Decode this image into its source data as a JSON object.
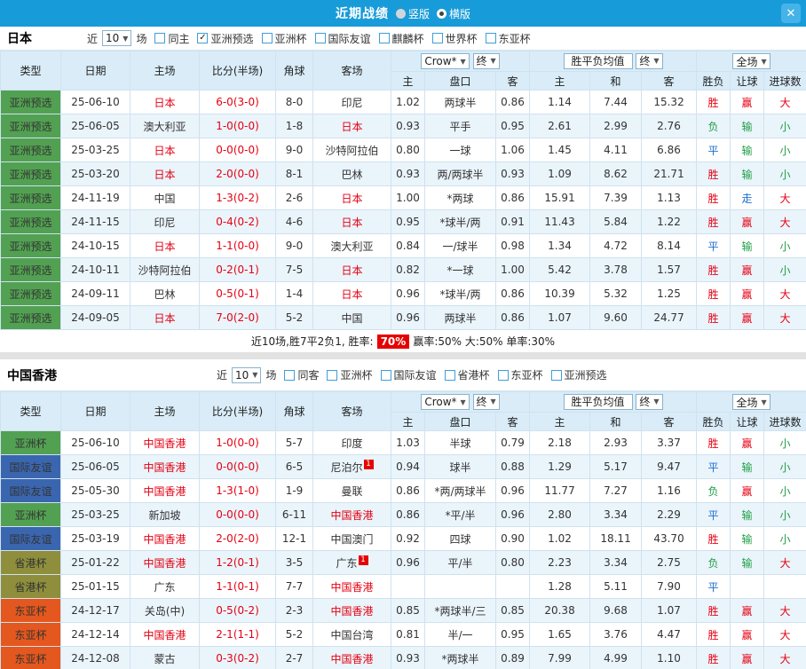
{
  "topbar": {
    "title": "近期战绩",
    "layout_options": [
      {
        "label": "竖版",
        "selected": false
      },
      {
        "label": "横版",
        "selected": true
      }
    ],
    "close_label": "✕"
  },
  "icons": {
    "dropdown": "▼",
    "check": "✓",
    "close": "✕"
  },
  "controls": {
    "near": "近",
    "games": "场",
    "odds_source": "Crow*",
    "final": "终",
    "avg_label": "胜平负均值",
    "scope": "全场"
  },
  "columns": {
    "type": "类型",
    "date": "日期",
    "home": "主场",
    "score": "比分(半场)",
    "corner": "角球",
    "away": "客场",
    "home_short": "主",
    "handicap": "盘口",
    "away_short": "客",
    "avg_home": "主",
    "avg_draw": "和",
    "avg_away": "客",
    "result": "胜负",
    "handicap_result": "让球",
    "goals": "进球数"
  },
  "colors": {
    "accent": "#189bd9",
    "score": "#e60012",
    "focus_team": "#e60012",
    "types": {
      "亚洲预选": "#52a152",
      "亚洲杯": "#52a152",
      "国际友谊": "#3a66b0",
      "省港杯": "#8e8e3c",
      "东亚杯": "#e4571e"
    },
    "outcomes": {
      "胜": "#e60012",
      "负": "#1f9e46",
      "平": "#1d6fd1",
      "赢": "#e60012",
      "输": "#1f9e46",
      "走": "#1d6fd1",
      "大": "#e60012",
      "小": "#1f9e46"
    }
  },
  "sections": [
    {
      "team": "日本",
      "filter": {
        "count": "10",
        "checkboxes": [
          {
            "label": "同主",
            "checked": false
          },
          {
            "label": "亚洲预选",
            "checked": true
          },
          {
            "label": "亚洲杯",
            "checked": false
          },
          {
            "label": "国际友谊",
            "checked": false
          },
          {
            "label": "麒麟杯",
            "checked": false
          },
          {
            "label": "世界杯",
            "checked": false
          },
          {
            "label": "东亚杯",
            "checked": false
          }
        ]
      },
      "rows": [
        {
          "type": "亚洲预选",
          "date": "25-06-10",
          "home": "日本",
          "score": "6-0(3-0)",
          "corner": "8-0",
          "away": "印尼",
          "o1": "1.02",
          "hc": "两球半",
          "o2": "0.86",
          "e1": "1.14",
          "e2": "7.44",
          "e3": "15.32",
          "wl": "胜",
          "rq": "赢",
          "gl": "大"
        },
        {
          "type": "亚洲预选",
          "date": "25-06-05",
          "home": "澳大利亚",
          "score": "1-0(0-0)",
          "corner": "1-8",
          "away": "日本",
          "o1": "0.93",
          "hc": "平手",
          "o2": "0.95",
          "e1": "2.61",
          "e2": "2.99",
          "e3": "2.76",
          "wl": "负",
          "rq": "输",
          "gl": "小"
        },
        {
          "type": "亚洲预选",
          "date": "25-03-25",
          "home": "日本",
          "score": "0-0(0-0)",
          "corner": "9-0",
          "away": "沙特阿拉伯",
          "o1": "0.80",
          "hc": "一球",
          "o2": "1.06",
          "e1": "1.45",
          "e2": "4.11",
          "e3": "6.86",
          "wl": "平",
          "rq": "输",
          "gl": "小"
        },
        {
          "type": "亚洲预选",
          "date": "25-03-20",
          "home": "日本",
          "score": "2-0(0-0)",
          "corner": "8-1",
          "away": "巴林",
          "o1": "0.93",
          "hc": "两/两球半",
          "o2": "0.93",
          "e1": "1.09",
          "e2": "8.62",
          "e3": "21.71",
          "wl": "胜",
          "rq": "输",
          "gl": "小"
        },
        {
          "type": "亚洲预选",
          "date": "24-11-19",
          "home": "中国",
          "score": "1-3(0-2)",
          "corner": "2-6",
          "away": "日本",
          "o1": "1.00",
          "hc": "*两球",
          "o2": "0.86",
          "e1": "15.91",
          "e2": "7.39",
          "e3": "1.13",
          "wl": "胜",
          "rq": "走",
          "gl": "大"
        },
        {
          "type": "亚洲预选",
          "date": "24-11-15",
          "home": "印尼",
          "score": "0-4(0-2)",
          "corner": "4-6",
          "away": "日本",
          "o1": "0.95",
          "hc": "*球半/两",
          "o2": "0.91",
          "e1": "11.43",
          "e2": "5.84",
          "e3": "1.22",
          "wl": "胜",
          "rq": "赢",
          "gl": "大"
        },
        {
          "type": "亚洲预选",
          "date": "24-10-15",
          "home": "日本",
          "score": "1-1(0-0)",
          "corner": "9-0",
          "away": "澳大利亚",
          "o1": "0.84",
          "hc": "一/球半",
          "o2": "0.98",
          "e1": "1.34",
          "e2": "4.72",
          "e3": "8.14",
          "wl": "平",
          "rq": "输",
          "gl": "小"
        },
        {
          "type": "亚洲预选",
          "date": "24-10-11",
          "home": "沙特阿拉伯",
          "score": "0-2(0-1)",
          "corner": "7-5",
          "away": "日本",
          "o1": "0.82",
          "hc": "*一球",
          "o2": "1.00",
          "e1": "5.42",
          "e2": "3.78",
          "e3": "1.57",
          "wl": "胜",
          "rq": "赢",
          "gl": "小"
        },
        {
          "type": "亚洲预选",
          "date": "24-09-11",
          "home": "巴林",
          "score": "0-5(0-1)",
          "corner": "1-4",
          "away": "日本",
          "o1": "0.96",
          "hc": "*球半/两",
          "o2": "0.86",
          "e1": "10.39",
          "e2": "5.32",
          "e3": "1.25",
          "wl": "胜",
          "rq": "赢",
          "gl": "大"
        },
        {
          "type": "亚洲预选",
          "date": "24-09-05",
          "home": "日本",
          "score": "7-0(2-0)",
          "corner": "5-2",
          "away": "中国",
          "o1": "0.96",
          "hc": "两球半",
          "o2": "0.86",
          "e1": "1.07",
          "e2": "9.60",
          "e3": "24.77",
          "wl": "胜",
          "rq": "赢",
          "gl": "大"
        }
      ],
      "summary": {
        "prefix": "近10场,胜7平2负1, 胜率:",
        "win_rate": "70%",
        "rest": "赢率:50% 大:50% 单率:30%"
      }
    },
    {
      "team": "中国香港",
      "filter": {
        "count": "10",
        "checkboxes": [
          {
            "label": "同客",
            "checked": false
          },
          {
            "label": "亚洲杯",
            "checked": false
          },
          {
            "label": "国际友谊",
            "checked": false
          },
          {
            "label": "省港杯",
            "checked": false
          },
          {
            "label": "东亚杯",
            "checked": false
          },
          {
            "label": "亚洲预选",
            "checked": false
          }
        ]
      },
      "rows": [
        {
          "type": "亚洲杯",
          "date": "25-06-10",
          "home": "中国香港",
          "score": "1-0(0-0)",
          "corner": "5-7",
          "away": "印度",
          "o1": "1.03",
          "hc": "半球",
          "o2": "0.79",
          "e1": "2.18",
          "e2": "2.93",
          "e3": "3.37",
          "wl": "胜",
          "rq": "赢",
          "gl": "小"
        },
        {
          "type": "国际友谊",
          "date": "25-06-05",
          "home": "中国香港",
          "score": "0-0(0-0)",
          "corner": "6-5",
          "away": "尼泊尔",
          "away_sup": "1",
          "o1": "0.94",
          "hc": "球半",
          "o2": "0.88",
          "e1": "1.29",
          "e2": "5.17",
          "e3": "9.47",
          "wl": "平",
          "rq": "输",
          "gl": "小"
        },
        {
          "type": "国际友谊",
          "date": "25-05-30",
          "home": "中国香港",
          "score": "1-3(1-0)",
          "corner": "1-9",
          "away": "曼联",
          "o1": "0.86",
          "hc": "*两/两球半",
          "o2": "0.96",
          "e1": "11.77",
          "e2": "7.27",
          "e3": "1.16",
          "wl": "负",
          "rq": "赢",
          "gl": "小"
        },
        {
          "type": "亚洲杯",
          "date": "25-03-25",
          "home": "新加坡",
          "score": "0-0(0-0)",
          "corner": "6-11",
          "away": "中国香港",
          "o1": "0.86",
          "hc": "*平/半",
          "o2": "0.96",
          "e1": "2.80",
          "e2": "3.34",
          "e3": "2.29",
          "wl": "平",
          "rq": "输",
          "gl": "小"
        },
        {
          "type": "国际友谊",
          "date": "25-03-19",
          "home": "中国香港",
          "score": "2-0(2-0)",
          "corner": "12-1",
          "away": "中国澳门",
          "o1": "0.92",
          "hc": "四球",
          "o2": "0.90",
          "e1": "1.02",
          "e2": "18.11",
          "e3": "43.70",
          "wl": "胜",
          "rq": "输",
          "gl": "小"
        },
        {
          "type": "省港杯",
          "date": "25-01-22",
          "home": "中国香港",
          "score": "1-2(0-1)",
          "corner": "3-5",
          "away": "广东",
          "away_sup": "1",
          "o1": "0.96",
          "hc": "平/半",
          "o2": "0.80",
          "e1": "2.23",
          "e2": "3.34",
          "e3": "2.75",
          "wl": "负",
          "rq": "输",
          "gl": "大"
        },
        {
          "type": "省港杯",
          "date": "25-01-15",
          "home": "广东",
          "score": "1-1(0-1)",
          "corner": "7-7",
          "away": "中国香港",
          "o1": "",
          "hc": "",
          "o2": "",
          "e1": "1.28",
          "e2": "5.11",
          "e3": "7.90",
          "wl": "平",
          "rq": "",
          "gl": ""
        },
        {
          "type": "东亚杯",
          "date": "24-12-17",
          "home": "关岛(中)",
          "score": "0-5(0-2)",
          "corner": "2-3",
          "away": "中国香港",
          "o1": "0.85",
          "hc": "*两球半/三",
          "o2": "0.85",
          "e1": "20.38",
          "e2": "9.68",
          "e3": "1.07",
          "wl": "胜",
          "rq": "赢",
          "gl": "大"
        },
        {
          "type": "东亚杯",
          "date": "24-12-14",
          "home": "中国香港",
          "score": "2-1(1-1)",
          "corner": "5-2",
          "away": "中国台湾",
          "o1": "0.81",
          "hc": "半/一",
          "o2": "0.95",
          "e1": "1.65",
          "e2": "3.76",
          "e3": "4.47",
          "wl": "胜",
          "rq": "赢",
          "gl": "大"
        },
        {
          "type": "东亚杯",
          "date": "24-12-08",
          "home": "蒙古",
          "score": "0-3(0-2)",
          "corner": "2-7",
          "away": "中国香港",
          "o1": "0.93",
          "hc": "*两球半",
          "o2": "0.89",
          "e1": "7.99",
          "e2": "4.99",
          "e3": "1.10",
          "wl": "胜",
          "rq": "赢",
          "gl": "大"
        }
      ]
    }
  ]
}
